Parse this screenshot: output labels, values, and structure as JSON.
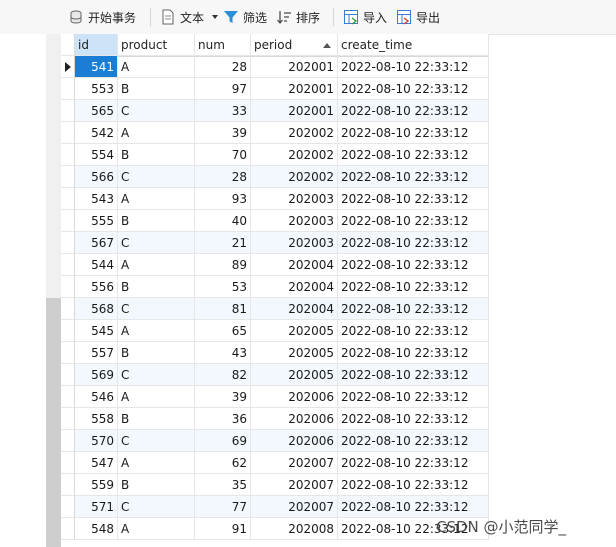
{
  "toolbar": {
    "begin_transaction": "开始事务",
    "text": "文本",
    "filter": "筛选",
    "sort": "排序",
    "import": "导入",
    "export": "导出"
  },
  "colors": {
    "selected_cell": "#1a7fd4",
    "header_id_bg": "#cde3f7",
    "alt_row": "#f2f8fd",
    "filter_icon": "#2a8fd8"
  },
  "grid": {
    "columns": [
      "id",
      "product",
      "num",
      "period",
      "create_time"
    ],
    "sorted_column": "period",
    "sort_direction": "ascending",
    "selected_row": 0,
    "rows": [
      {
        "id": "541",
        "product": "A",
        "num": "28",
        "period": "202001",
        "create_time": "2022-08-10 22:33:12"
      },
      {
        "id": "553",
        "product": "B",
        "num": "97",
        "period": "202001",
        "create_time": "2022-08-10 22:33:12"
      },
      {
        "id": "565",
        "product": "C",
        "num": "33",
        "period": "202001",
        "create_time": "2022-08-10 22:33:12"
      },
      {
        "id": "542",
        "product": "A",
        "num": "39",
        "period": "202002",
        "create_time": "2022-08-10 22:33:12"
      },
      {
        "id": "554",
        "product": "B",
        "num": "70",
        "period": "202002",
        "create_time": "2022-08-10 22:33:12"
      },
      {
        "id": "566",
        "product": "C",
        "num": "28",
        "period": "202002",
        "create_time": "2022-08-10 22:33:12"
      },
      {
        "id": "543",
        "product": "A",
        "num": "93",
        "period": "202003",
        "create_time": "2022-08-10 22:33:12"
      },
      {
        "id": "555",
        "product": "B",
        "num": "40",
        "period": "202003",
        "create_time": "2022-08-10 22:33:12"
      },
      {
        "id": "567",
        "product": "C",
        "num": "21",
        "period": "202003",
        "create_time": "2022-08-10 22:33:12"
      },
      {
        "id": "544",
        "product": "A",
        "num": "89",
        "period": "202004",
        "create_time": "2022-08-10 22:33:12"
      },
      {
        "id": "556",
        "product": "B",
        "num": "53",
        "period": "202004",
        "create_time": "2022-08-10 22:33:12"
      },
      {
        "id": "568",
        "product": "C",
        "num": "81",
        "period": "202004",
        "create_time": "2022-08-10 22:33:12"
      },
      {
        "id": "545",
        "product": "A",
        "num": "65",
        "period": "202005",
        "create_time": "2022-08-10 22:33:12"
      },
      {
        "id": "557",
        "product": "B",
        "num": "43",
        "period": "202005",
        "create_time": "2022-08-10 22:33:12"
      },
      {
        "id": "569",
        "product": "C",
        "num": "82",
        "period": "202005",
        "create_time": "2022-08-10 22:33:12"
      },
      {
        "id": "546",
        "product": "A",
        "num": "39",
        "period": "202006",
        "create_time": "2022-08-10 22:33:12"
      },
      {
        "id": "558",
        "product": "B",
        "num": "36",
        "period": "202006",
        "create_time": "2022-08-10 22:33:12"
      },
      {
        "id": "570",
        "product": "C",
        "num": "69",
        "period": "202006",
        "create_time": "2022-08-10 22:33:12"
      },
      {
        "id": "547",
        "product": "A",
        "num": "62",
        "period": "202007",
        "create_time": "2022-08-10 22:33:12"
      },
      {
        "id": "559",
        "product": "B",
        "num": "35",
        "period": "202007",
        "create_time": "2022-08-10 22:33:12"
      },
      {
        "id": "571",
        "product": "C",
        "num": "77",
        "period": "202007",
        "create_time": "2022-08-10 22:33:12"
      },
      {
        "id": "548",
        "product": "A",
        "num": "91",
        "period": "202008",
        "create_time": "2022-08-10 22:33:12"
      }
    ]
  },
  "watermark": "CSDN @小范同学_"
}
